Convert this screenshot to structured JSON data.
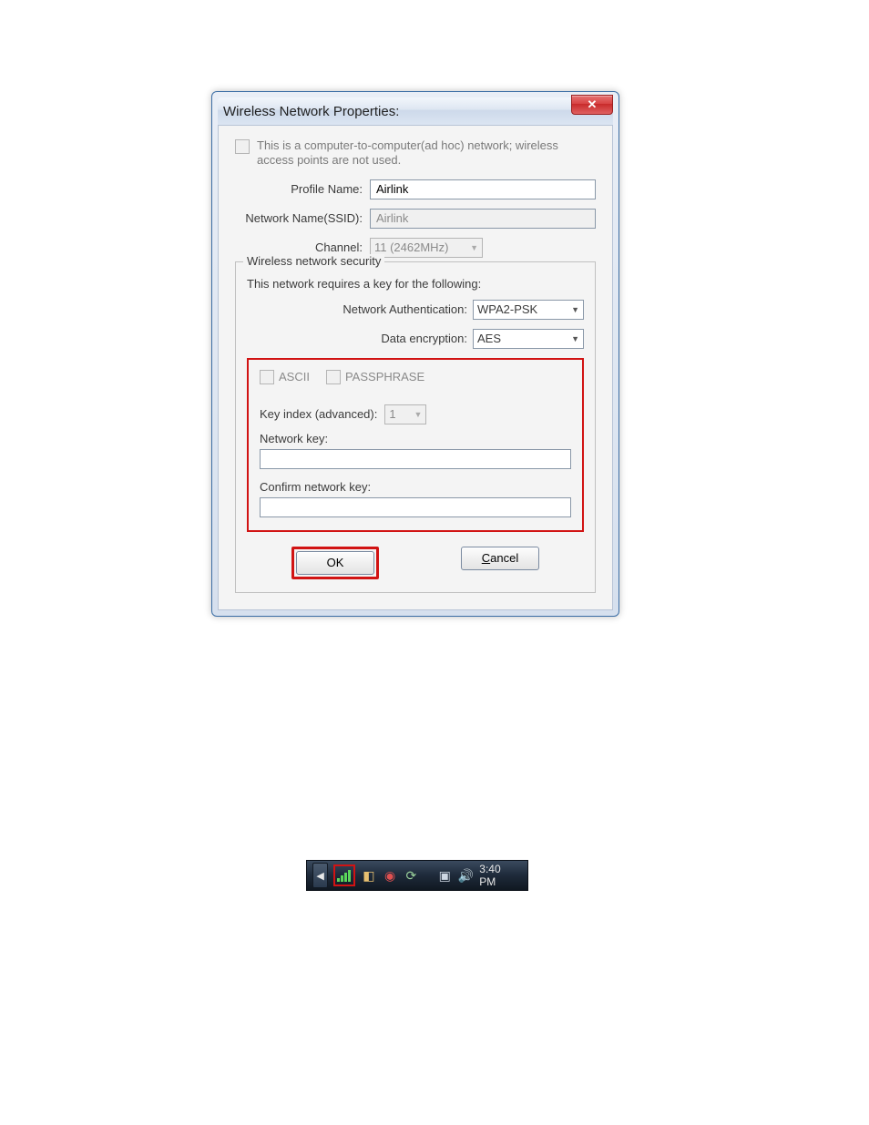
{
  "dialog": {
    "title": "Wireless Network Properties:",
    "close_glyph": "✕",
    "adhoc_text": "This is a computer-to-computer(ad hoc) network; wireless access points are not used.",
    "profile_label": "Profile Name:",
    "profile_value": "Airlink",
    "ssid_label": "Network Name(SSID):",
    "ssid_value": "Airlink",
    "channel_label": "Channel:",
    "channel_value": "11 (2462MHz)",
    "security_legend": "Wireless network security",
    "security_note": "This network requires a key for the following:",
    "auth_label": "Network Authentication:",
    "auth_value": "WPA2-PSK",
    "enc_label": "Data encryption:",
    "enc_value": "AES",
    "opt_ascii": "ASCII",
    "opt_pass": "PASSPHRASE",
    "keyidx_label": "Key index (advanced):",
    "keyidx_value": "1",
    "netkey_label": "Network key:",
    "confirm_label": "Confirm network key:",
    "ok_label": "OK",
    "cancel_prefix": "C",
    "cancel_rest": "ancel"
  },
  "tray": {
    "time": "3:40 PM"
  }
}
